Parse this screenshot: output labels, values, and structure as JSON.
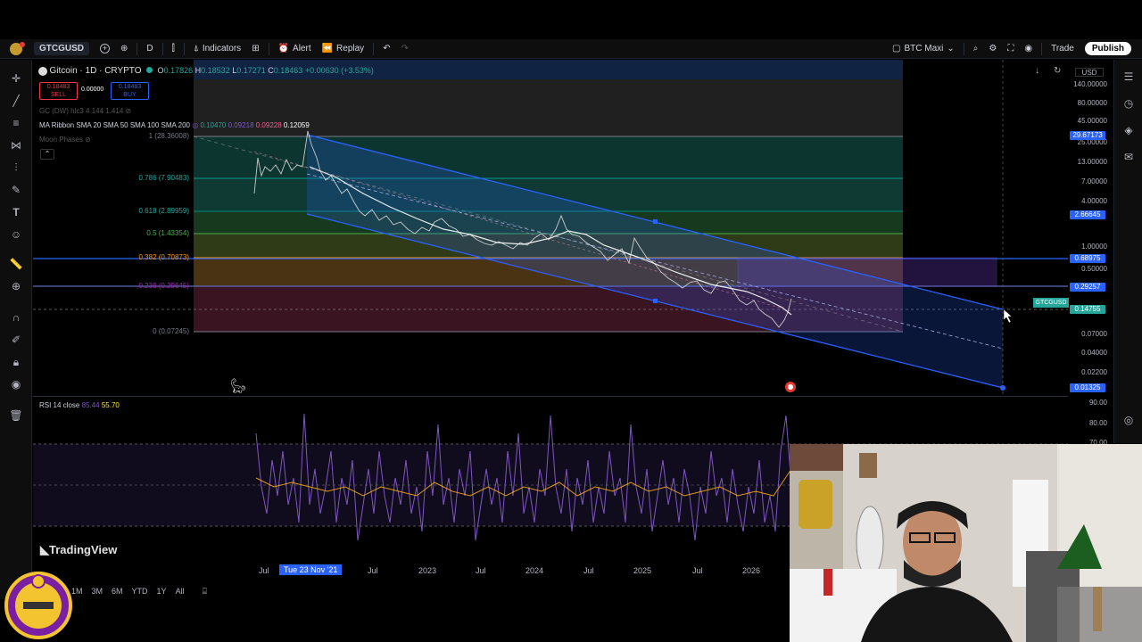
{
  "topbar": {
    "symbol": "GTCGUSD",
    "interval": "D",
    "indicators_label": "Indicators",
    "alert_label": "Alert",
    "replay_label": "Replay",
    "layout_name": "BTC Maxi",
    "trade_label": "Trade",
    "publish_label": "Publish"
  },
  "legend": {
    "title": "Gitcoin · 1D · CRYPTO",
    "open": "O",
    "open_val": "0.17826",
    "high": "H",
    "high_val": "0.18532",
    "low": "L",
    "low_val": "0.17271",
    "close": "C",
    "close_val": "0.18463",
    "change": "+0.00630 (+3.53%)",
    "sell_price": "0.18483",
    "sell_label": "SELL",
    "spread": "0.00000",
    "buy_price": "0.18483",
    "buy_label": "BUY",
    "gc_line": "GC (DW) hlc3 4 144 1.414",
    "ribbon_label": "MA Ribbon SMA 20 SMA 50 SMA 100 SMA 200",
    "ribbon_v1": "0.10470",
    "ribbon_v2": "0.09218",
    "ribbon_v3": "0.09228",
    "ribbon_v4": "0.12059",
    "moon": "Moon Phases"
  },
  "fib": [
    {
      "label": "1 (28.36008)"
    },
    {
      "label": "0.786 (7.90483)"
    },
    {
      "label": "0.618 (2.89959)"
    },
    {
      "label": "0.5 (1.43354)"
    },
    {
      "label": "0.382 (0.70873)"
    },
    {
      "label": "0.236 (0.29645)"
    },
    {
      "label": "0 (0.07245)"
    }
  ],
  "price_axis": {
    "currency": "USD",
    "labels": [
      "140.00000",
      "80.00000",
      "45.00000",
      "25.00000",
      "13.00000",
      "7.00000",
      "4.00000",
      "1.00000",
      "0.50000",
      "0.07000",
      "0.04000",
      "0.02200"
    ],
    "tag_top": "29.67173",
    "tag_mid": "2.66645",
    "tag_blue1": "0.68975",
    "tag_blue2": "0.29257",
    "tag_cur": "0.14755",
    "tag_low": "0.01325",
    "symbol_tag": "GTCGUSD",
    "rsi_labels": [
      "90.00",
      "80.00",
      "70.00"
    ]
  },
  "rsi": {
    "label": "RSI 14 close",
    "v1": "85.44",
    "v2": "55.70"
  },
  "time_axis": {
    "labels": [
      "Jul",
      "Tue 23 Nov '21",
      "Jul",
      "2023",
      "Jul",
      "2024",
      "Jul",
      "2025",
      "Jul",
      "2026"
    ]
  },
  "bottombar": {
    "ranges": [
      "1M",
      "3M",
      "6M",
      "YTD",
      "1Y",
      "All"
    ]
  },
  "watermark": "TradingView",
  "colors": {
    "fib_1": "#787b86",
    "fib_786": "#089981",
    "fib_618": "#00897b",
    "fib_5": "#4caf50",
    "fib_382": "#f57c00",
    "fib_236": "#9c27b0",
    "fib_0": "#787b86",
    "channel": "#2962ff",
    "rsi": "#7e57c2"
  }
}
